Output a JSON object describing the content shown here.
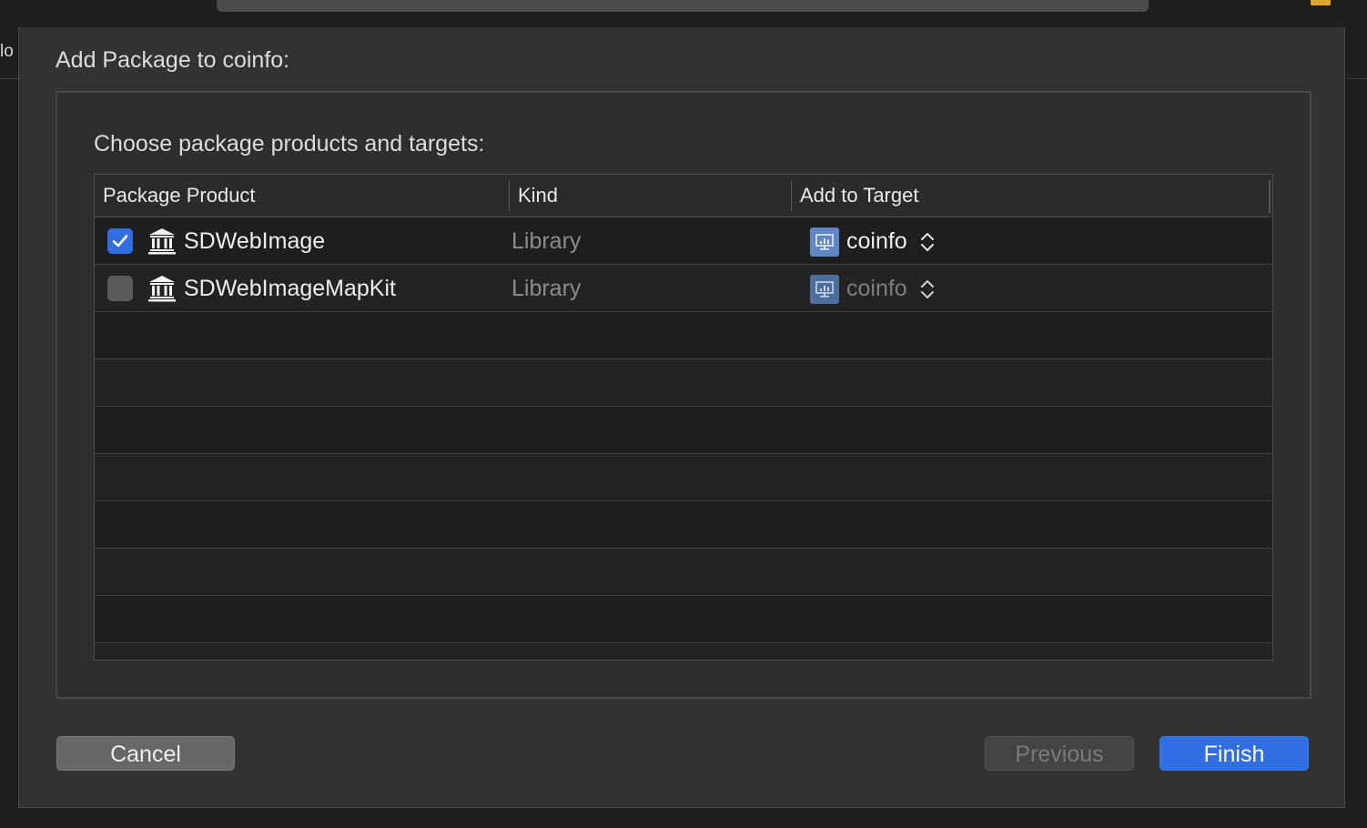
{
  "background": {
    "side_fragment": "lo"
  },
  "sheet": {
    "title": "Add Package to coinfo:",
    "subtitle": "Choose package products and targets:",
    "table": {
      "columns": [
        "Package Product",
        "Kind",
        "Add to Target"
      ],
      "rows": [
        {
          "checked": true,
          "product": "SDWebImage",
          "product_icon": "library-building-icon",
          "kind": "Library",
          "target": "coinfo",
          "target_icon": "app-target-icon",
          "target_enabled": true
        },
        {
          "checked": false,
          "product": "SDWebImageMapKit",
          "product_icon": "library-building-icon",
          "kind": "Library",
          "target": "coinfo",
          "target_icon": "app-target-icon",
          "target_enabled": false
        }
      ]
    },
    "buttons": {
      "cancel": "Cancel",
      "previous": "Previous",
      "finish": "Finish"
    }
  },
  "colors": {
    "accent": "#2f6fe3",
    "sheet_bg": "#323233",
    "table_bg": "#1e1e1e",
    "warning": "#e0a530"
  }
}
